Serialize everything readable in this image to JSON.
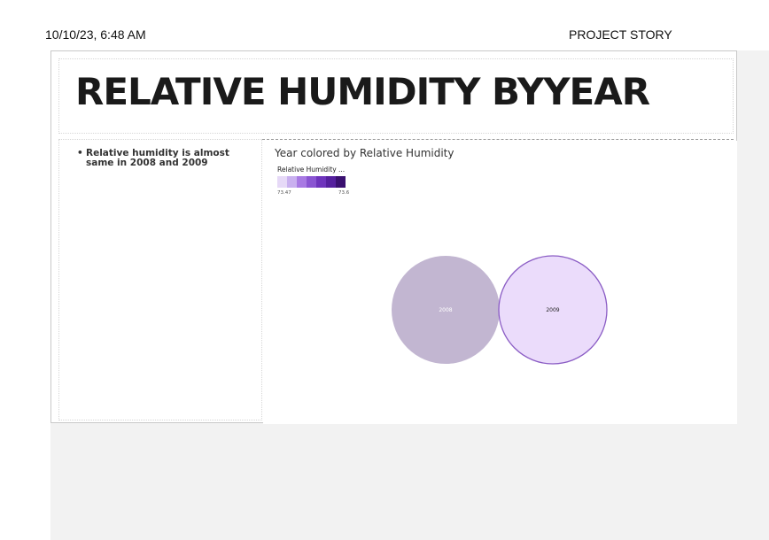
{
  "print_header": {
    "datetime": "10/10/23, 6:48 AM",
    "story_title": "PROJECT STORY"
  },
  "story": {
    "title": "RELATIVE HUMIDITY BYYEAR",
    "bullets": [
      "Relative humidity is almost same in 2008 and 2009"
    ]
  },
  "viz": {
    "title": "Year colored by Relative Humidity",
    "legend": {
      "title": "Relative Humidity ...",
      "min_label": "73.47",
      "max_label": "73.6",
      "colors": [
        "#e6d9f7",
        "#c9b0ef",
        "#a87ae3",
        "#8a55d2",
        "#6e34bc",
        "#55209e",
        "#3a1070"
      ]
    },
    "circles": [
      {
        "label": "2008",
        "fill": "#c2b6d1",
        "stroke": "none",
        "text_color": "#ffffff"
      },
      {
        "label": "2009",
        "fill": "#ebdcfb",
        "stroke": "#8a5cc4",
        "text_color": "#222222"
      }
    ]
  }
}
